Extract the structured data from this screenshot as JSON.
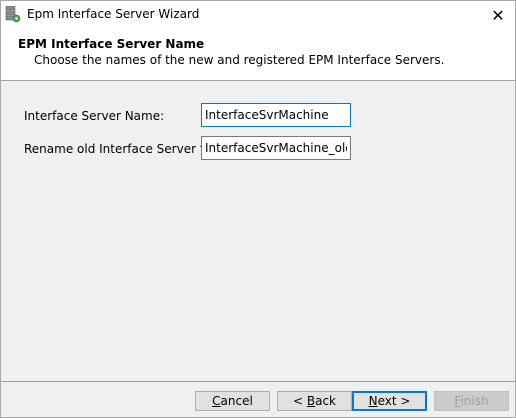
{
  "window": {
    "title": "Epm Interface Server Wizard",
    "close_glyph": "✕"
  },
  "header": {
    "title": "EPM Interface Server Name",
    "subtitle": "Choose the names of the new and registered EPM Interface Servers."
  },
  "form": {
    "server_name_label": "Interface Server Name:",
    "server_name_value": "InterfaceSvrMachine",
    "rename_label": "Rename old Interface Server to:",
    "rename_value": "InterfaceSvrMachine_old"
  },
  "buttons": {
    "cancel": {
      "pre": "",
      "mnemonic": "C",
      "post": "ancel"
    },
    "back": {
      "pre": "< ",
      "mnemonic": "B",
      "post": "ack"
    },
    "next": {
      "pre": "",
      "mnemonic": "N",
      "post": "ext >"
    },
    "finish": {
      "pre": "",
      "mnemonic": "F",
      "post": "inish"
    }
  },
  "colors": {
    "focus_border": "#0078d7",
    "dialog_bg": "#f0f0f0"
  }
}
